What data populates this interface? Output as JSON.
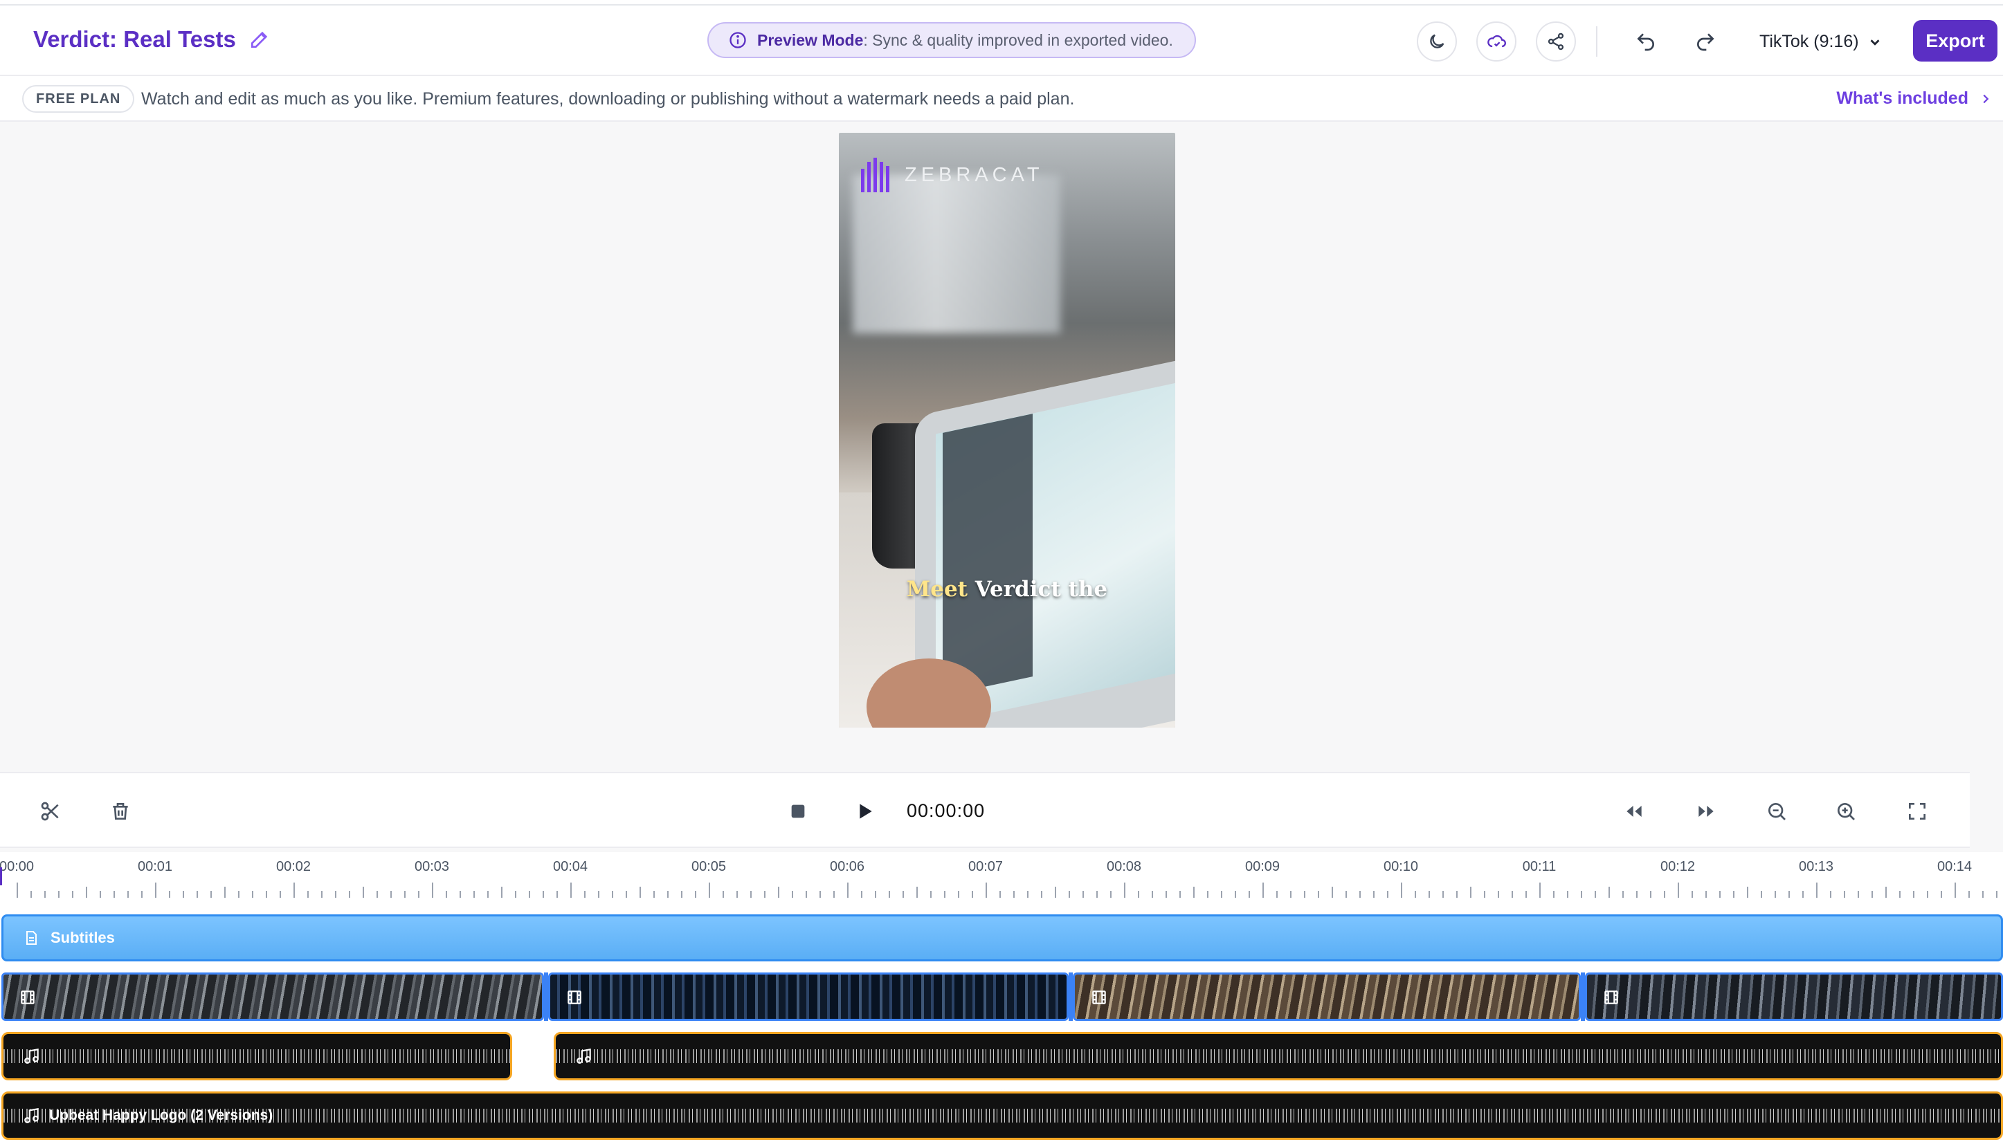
{
  "header": {
    "title": "Verdict: Real Tests",
    "preview_mode_label": "Preview Mode",
    "preview_mode_text": ": Sync & quality improved in exported video.",
    "format_label": "TikTok (9:16)",
    "export_label": "Export"
  },
  "banner": {
    "plan_badge": "FREE PLAN",
    "message": "Watch and edit as much as you like. Premium features, downloading or publishing without a watermark needs a paid plan.",
    "link": "What's included"
  },
  "video": {
    "logo_text": "ZEBRACAT",
    "caption_highlight": "Meet",
    "caption_rest": " Verdict the"
  },
  "controls": {
    "timecode": "00:00:00"
  },
  "timeline": {
    "ticks": [
      "00:00",
      "00:01",
      "00:02",
      "00:03",
      "00:04",
      "00:05",
      "00:06",
      "00:07",
      "00:08",
      "00:09",
      "00:10",
      "00:11",
      "00:12",
      "00:13",
      "00:14"
    ],
    "subtitles_label": "Subtitles",
    "music_label": "Upbeat Happy Logo (2 Versions)"
  },
  "icons": {
    "edit": "pencil-icon",
    "info": "info-icon",
    "theme": "moon-icon",
    "cloud": "cloud-check-icon",
    "share": "share-icon",
    "undo": "undo-icon",
    "redo": "redo-icon",
    "cut": "scissors-icon",
    "delete": "trash-icon",
    "stop": "stop-icon",
    "play": "play-icon",
    "rewind": "rewind-icon",
    "forward": "fast-forward-icon",
    "zoom_out": "zoom-out-icon",
    "zoom_in": "zoom-in-icon",
    "fullscreen": "fullscreen-icon"
  },
  "colors": {
    "brand": "#5b2fc4",
    "subtitle_track": "#5aaef5",
    "audio_border": "#f5a623"
  }
}
